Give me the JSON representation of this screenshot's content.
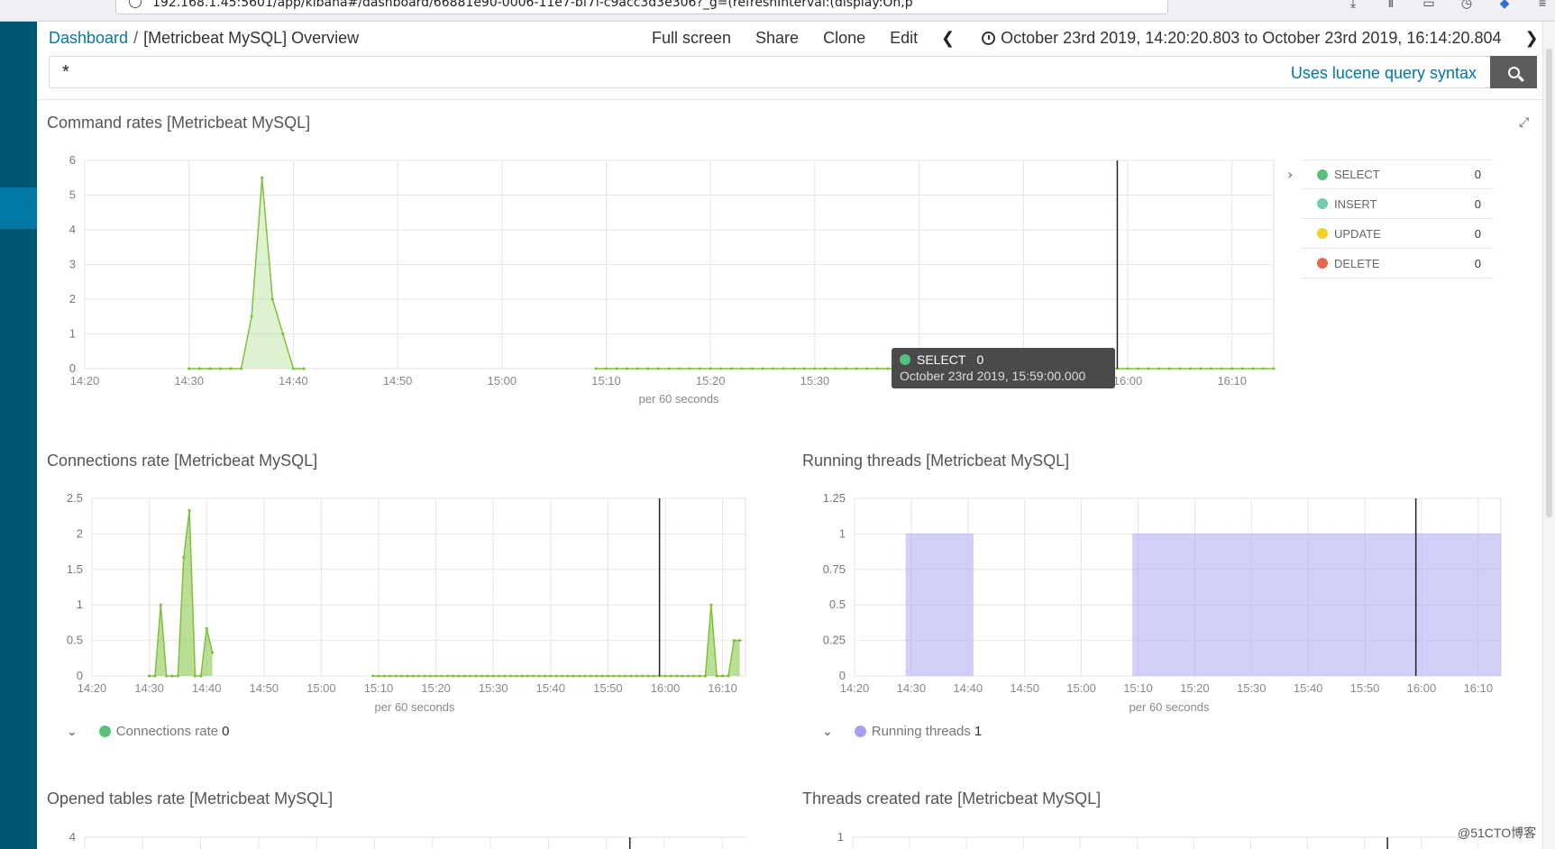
{
  "browser": {
    "url": "192.168.1.45:5601/app/kibana#/dashboard/66881e90-0006-11e7-bf7f-c9acc3d3e306?_g=(refreshInterval:(display:On,p",
    "icons": [
      "download-icon",
      "library-icon",
      "sidebar-icon",
      "history-icon",
      "extension-icon",
      "menu-icon"
    ]
  },
  "breadcrumb": {
    "root": "Dashboard",
    "separator": "/",
    "current": "[Metricbeat MySQL] Overview"
  },
  "actions": [
    "Full screen",
    "Share",
    "Clone",
    "Edit"
  ],
  "timepicker": {
    "range": "October 23rd 2019, 14:20:20.803 to October 23rd 2019, 16:14:20.804"
  },
  "query": {
    "value": "*",
    "syntax_link": "Uses lucene query syntax"
  },
  "panels": {
    "command_rates": {
      "title": "Command rates [Metricbeat MySQL]"
    },
    "connections_rate": {
      "title": "Connections rate [Metricbeat MySQL]"
    },
    "running_threads": {
      "title": "Running threads [Metricbeat MySQL]"
    },
    "opened_tables": {
      "title": "Opened tables rate [Metricbeat MySQL]"
    },
    "threads_created": {
      "title": "Threads created rate [Metricbeat MySQL]"
    }
  },
  "command_legend": [
    {
      "label": "SELECT",
      "value": "0",
      "color": "#57c17b"
    },
    {
      "label": "INSERT",
      "value": "0",
      "color": "#6dccb1"
    },
    {
      "label": "UPDATE",
      "value": "0",
      "color": "#f2d024"
    },
    {
      "label": "DELETE",
      "value": "0",
      "color": "#e7664c"
    }
  ],
  "connections_legend": {
    "label": "Connections rate",
    "value": "0",
    "color": "#57c17b"
  },
  "threads_legend": {
    "label": "Running threads",
    "value": "1",
    "color": "#a69ff2"
  },
  "tooltip": {
    "series": "SELECT",
    "value": "0",
    "time": "October 23rd 2019, 15:59:00.000",
    "color": "#57c17b"
  },
  "watermark": "@51CTO博客",
  "chart_data": [
    {
      "type": "area",
      "title": "Command rates [Metricbeat MySQL]",
      "xlabel": "per 60 seconds",
      "x_ticks": [
        "14:20",
        "14:30",
        "14:40",
        "14:50",
        "15:00",
        "15:10",
        "15:20",
        "15:30",
        "15:40",
        "15:50",
        "16:00",
        "16:10"
      ],
      "y_ticks": [
        "0",
        "1",
        "2",
        "3",
        "4",
        "5",
        "6"
      ],
      "ylim": [
        0,
        6
      ],
      "cursor_x": "15:59",
      "series": [
        {
          "name": "SELECT",
          "color": "#57c17b",
          "points": [
            [
              "14:30",
              0
            ],
            [
              "14:31",
              0
            ],
            [
              "14:32",
              0
            ],
            [
              "14:33",
              0
            ],
            [
              "14:34",
              0
            ],
            [
              "14:35",
              0
            ],
            [
              "14:36",
              1.5
            ],
            [
              "14:37",
              5.5
            ],
            [
              "14:38",
              2
            ],
            [
              "14:39",
              1
            ],
            [
              "14:40",
              0
            ],
            [
              "14:41",
              0
            ]
          ],
          "flat_ranges": [
            [
              "15:09",
              "16:14",
              0
            ]
          ]
        }
      ]
    },
    {
      "type": "area",
      "title": "Connections rate [Metricbeat MySQL]",
      "xlabel": "per 60 seconds",
      "x_ticks": [
        "14:20",
        "14:30",
        "14:40",
        "14:50",
        "15:00",
        "15:10",
        "15:20",
        "15:30",
        "15:40",
        "15:50",
        "16:00",
        "16:10"
      ],
      "y_ticks": [
        "0",
        "0.5",
        "1",
        "1.5",
        "2",
        "2.5"
      ],
      "ylim": [
        0,
        2.5
      ],
      "cursor_x": "15:59",
      "series": [
        {
          "name": "Connections rate",
          "color": "#57c17b",
          "points": [
            [
              "14:30",
              0
            ],
            [
              "14:31",
              0
            ],
            [
              "14:32",
              1
            ],
            [
              "14:33",
              0
            ],
            [
              "14:34",
              0
            ],
            [
              "14:35",
              0
            ],
            [
              "14:36",
              1.67
            ],
            [
              "14:37",
              2.33
            ],
            [
              "14:38",
              0
            ],
            [
              "14:39",
              0
            ],
            [
              "14:40",
              0.67
            ],
            [
              "14:41",
              0.33
            ]
          ],
          "points_late": [
            [
              "16:07",
              0
            ],
            [
              "16:08",
              1
            ],
            [
              "16:09",
              0
            ],
            [
              "16:10",
              0
            ],
            [
              "16:11",
              0
            ],
            [
              "16:12",
              0.5
            ],
            [
              "16:13",
              0.5
            ]
          ],
          "flat_ranges": [
            [
              "15:09",
              "16:07",
              0
            ]
          ]
        }
      ]
    },
    {
      "type": "area",
      "title": "Running threads [Metricbeat MySQL]",
      "xlabel": "per 60 seconds",
      "x_ticks": [
        "14:20",
        "14:30",
        "14:40",
        "14:50",
        "15:00",
        "15:10",
        "15:20",
        "15:30",
        "15:40",
        "15:50",
        "16:00",
        "16:10"
      ],
      "y_ticks": [
        "0",
        "0.25",
        "0.5",
        "0.75",
        "1",
        "1.25"
      ],
      "ylim": [
        0,
        1.25
      ],
      "cursor_x": "15:59",
      "series": [
        {
          "name": "Running threads",
          "color": "#a69ff2",
          "ranges": [
            [
              "14:29",
              "14:41",
              1
            ],
            [
              "15:09",
              "16:14",
              1
            ]
          ]
        }
      ]
    },
    {
      "type": "area",
      "title": "Opened tables rate [Metricbeat MySQL]",
      "y_ticks": [
        "4"
      ]
    },
    {
      "type": "area",
      "title": "Threads created rate [Metricbeat MySQL]",
      "y_ticks": [
        "1"
      ]
    }
  ]
}
